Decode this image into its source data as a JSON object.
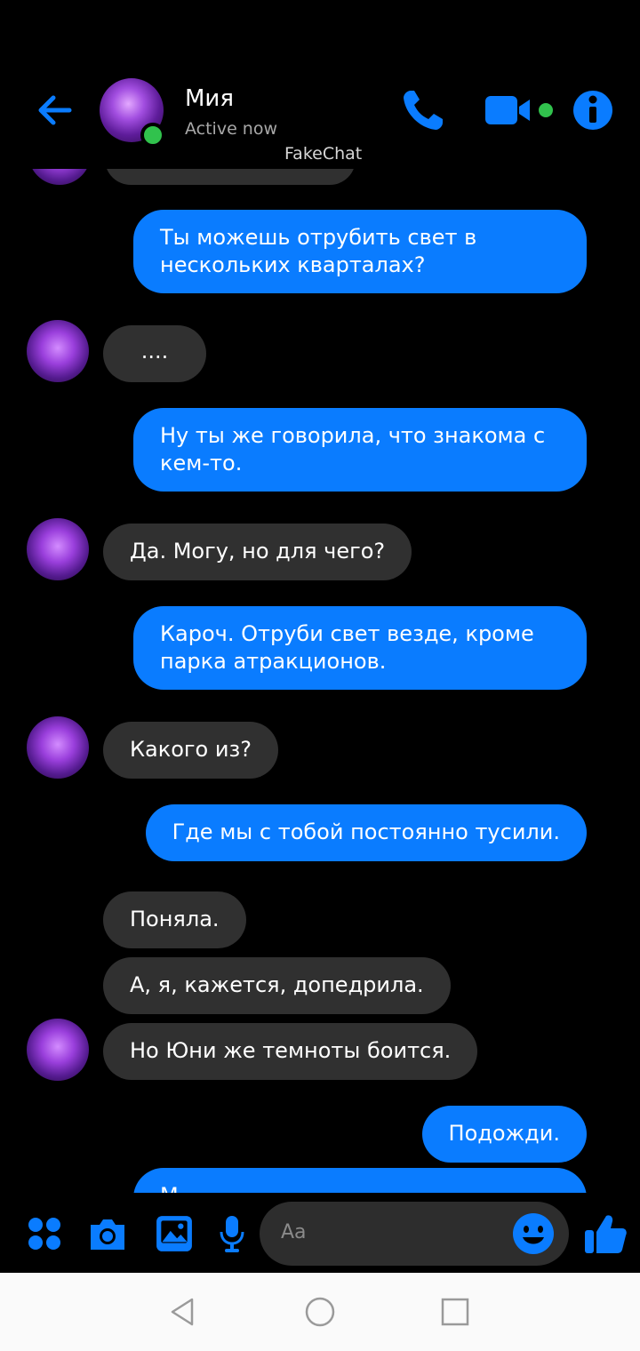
{
  "header": {
    "contact_name": "Мия",
    "status": "Active now",
    "watermark": "FakeChat"
  },
  "messages": [
    {
      "side": "in",
      "text": "...."
    },
    {
      "side": "out",
      "text": "Ты можешь отрубить свет в нескольких кварталах?"
    },
    {
      "side": "out",
      "text": "Ну ты же говорила, что знакома с кем-то."
    },
    {
      "side": "in",
      "text": "Да. Могу, но для чего?"
    },
    {
      "side": "out",
      "text": "Кароч. Отруби свет везде, кроме парка атракционов."
    },
    {
      "side": "in",
      "text": "Какого из?"
    },
    {
      "side": "out",
      "text": "Где мы с тобой постоянно тусили."
    },
    {
      "side": "in",
      "text": "Поняла."
    },
    {
      "side": "in",
      "text": "А, я, кажется, допедрила."
    },
    {
      "side": "in",
      "text": "Но Юни же темноты боится."
    },
    {
      "side": "out",
      "text": "Подожди."
    },
    {
      "side": "out",
      "text": "М..."
    }
  ],
  "composer": {
    "placeholder": "Aa",
    "icons": [
      "apps-icon",
      "camera-icon",
      "gallery-icon",
      "microphone-icon",
      "emoji-icon",
      "like-icon"
    ]
  },
  "navbar": {
    "icons": [
      "back-triangle-icon",
      "home-circle-icon",
      "recents-square-icon"
    ]
  },
  "colors": {
    "accent": "#0a7cff",
    "incoming_bubble": "#303030",
    "online": "#31c24d",
    "background": "#000000"
  }
}
